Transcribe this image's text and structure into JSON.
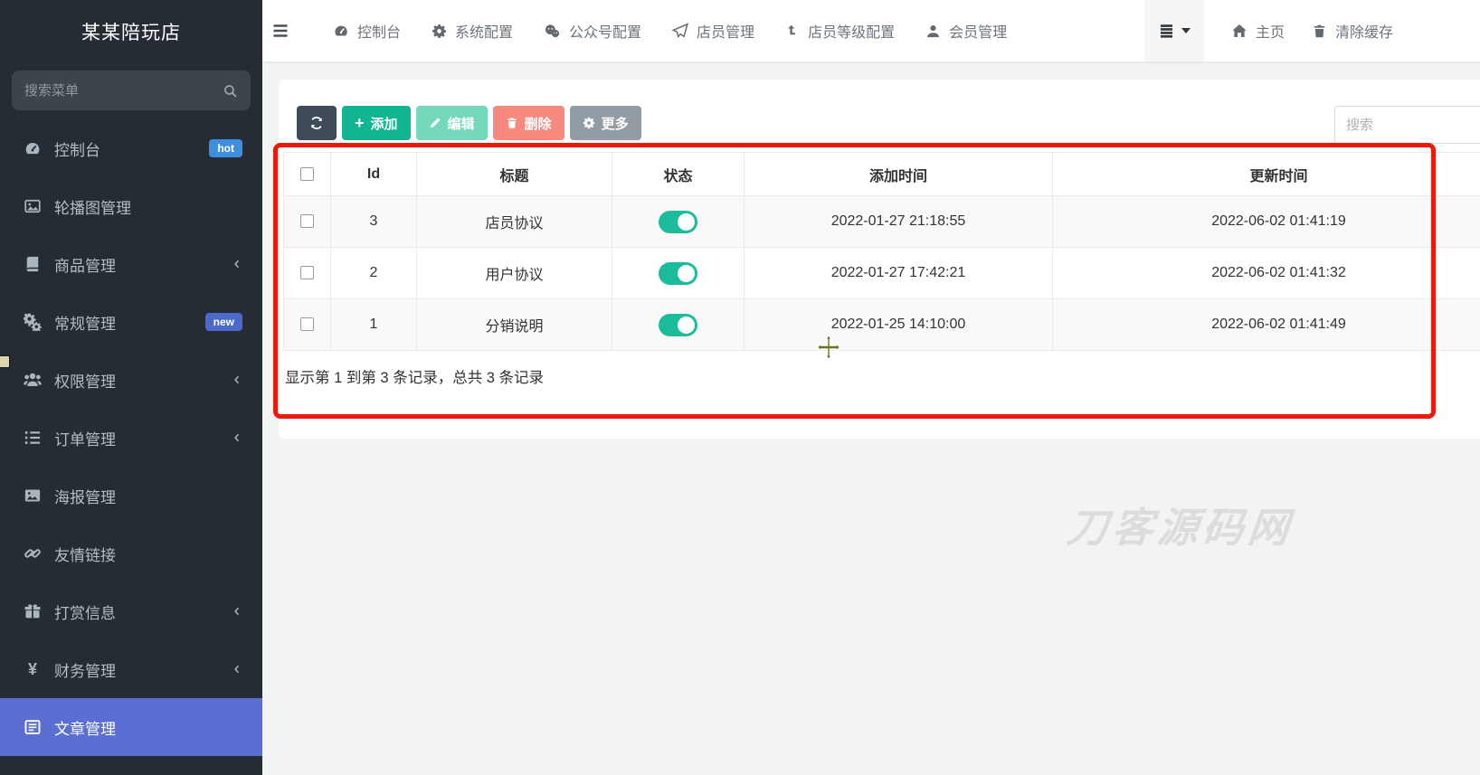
{
  "sidebar": {
    "brand": "某某陪玩店",
    "search_placeholder": "搜索菜单",
    "items": [
      {
        "label": "控制台",
        "icon": "dashboard-icon",
        "badge": "hot"
      },
      {
        "label": "轮播图管理",
        "icon": "carousel-image-icon"
      },
      {
        "label": "商品管理",
        "icon": "book-icon",
        "chevron": true
      },
      {
        "label": "常规管理",
        "icon": "gears-icon",
        "badge": "new"
      },
      {
        "label": "权限管理",
        "icon": "users-icon",
        "chevron": true
      },
      {
        "label": "订单管理",
        "icon": "list-icon",
        "chevron": true
      },
      {
        "label": "海报管理",
        "icon": "poster-image-icon"
      },
      {
        "label": "友情链接",
        "icon": "link-icon"
      },
      {
        "label": "打赏信息",
        "icon": "gift-icon",
        "chevron": true
      },
      {
        "label": "财务管理",
        "icon": "yen-icon",
        "chevron": true
      },
      {
        "label": "文章管理",
        "icon": "article-icon",
        "active": true
      }
    ]
  },
  "topnav": {
    "items": [
      {
        "label": "控制台",
        "icon": "dashboard-icon"
      },
      {
        "label": "系统配置",
        "icon": "gear-icon"
      },
      {
        "label": "公众号配置",
        "icon": "wechat-icon"
      },
      {
        "label": "店员管理",
        "icon": "paper-plane-icon"
      },
      {
        "label": "店员等级配置",
        "icon": "level-up-icon"
      },
      {
        "label": "会员管理",
        "icon": "user-icon"
      }
    ],
    "right": [
      {
        "label": "主页",
        "icon": "home-icon"
      },
      {
        "label": "清除缓存",
        "icon": "trash-icon"
      }
    ]
  },
  "toolbar": {
    "add_label": "添加",
    "edit_label": "编辑",
    "delete_label": "删除",
    "more_label": "更多",
    "search_placeholder": "搜索"
  },
  "table": {
    "headers": [
      "Id",
      "标题",
      "状态",
      "添加时间",
      "更新时间"
    ],
    "rows": [
      {
        "id": "3",
        "title": "店员协议",
        "status_on": true,
        "created": "2022-01-27 21:18:55",
        "updated": "2022-06-02 01:41:19"
      },
      {
        "id": "2",
        "title": "用户协议",
        "status_on": true,
        "created": "2022-01-27 17:42:21",
        "updated": "2022-06-02 01:41:32"
      },
      {
        "id": "1",
        "title": "分销说明",
        "status_on": true,
        "created": "2022-01-25 14:10:00",
        "updated": "2022-06-02 01:41:49"
      }
    ],
    "footer": "显示第 1 到第 3 条记录，总共 3 条记录"
  },
  "watermark": "刀客源码网",
  "colors": {
    "sidebar_bg": "#252c33",
    "active_item": "#5a6fd1",
    "hot_badge": "#3d8edb",
    "new_badge": "#4b69c9",
    "toggle_on": "#1abc9c",
    "add_button": "#12b591",
    "edit_button": "#74d8bd",
    "delete_button": "#f7897f",
    "more_button": "#919ca5",
    "refresh_button": "#404b59",
    "annotation_red": "#ec1a0d"
  }
}
